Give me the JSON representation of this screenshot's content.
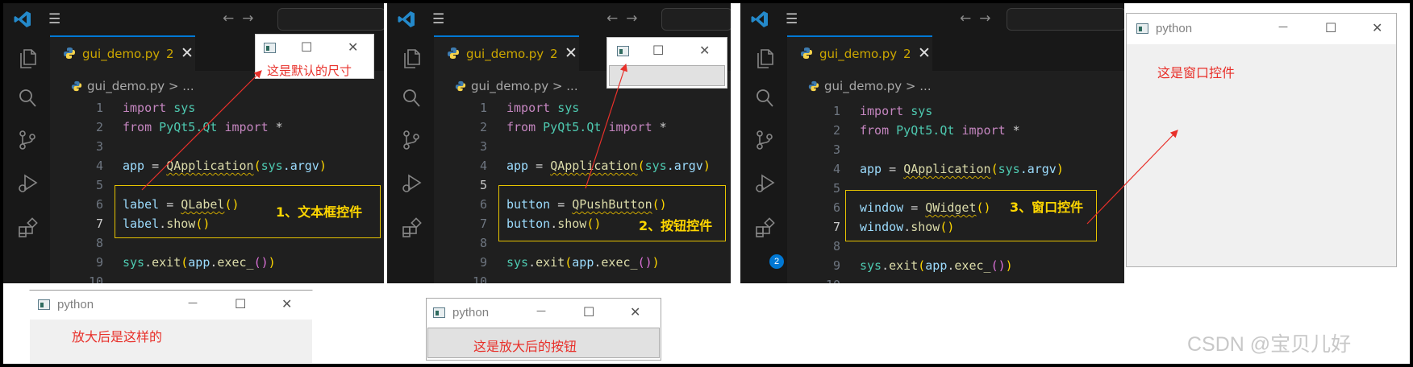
{
  "panels": [
    {
      "tab": {
        "filename": "gui_demo.py",
        "problems": "2",
        "close": "✕"
      },
      "breadcrumb": {
        "file": "gui_demo.py",
        "sep": ">",
        "rest": "..."
      },
      "line_numbers": [
        "1",
        "2",
        "3",
        "4",
        "5",
        "6",
        "7",
        "8",
        "9",
        "10"
      ],
      "code": {
        "l1": {
          "kw": "import",
          "mod": "sys"
        },
        "l2": {
          "kw1": "from",
          "mod": "PyQt5.Qt",
          "kw2": "import",
          "star": "*"
        },
        "l4": {
          "var": "app",
          "eq": "=",
          "fn": "QApplication",
          "mod": "sys",
          "attr": ".argv"
        },
        "l6": {
          "var": "label",
          "eq": "=",
          "fn": "QLabel"
        },
        "l7": {
          "var": "label",
          "method": "show"
        },
        "l9": {
          "mod": "sys",
          "fn": "exit",
          "var": "app",
          "method": "exec_"
        }
      },
      "annotation": "1、文本框控件"
    },
    {
      "tab": {
        "filename": "gui_demo.py",
        "problems": "2",
        "close": "✕"
      },
      "breadcrumb": {
        "file": "gui_demo.py",
        "sep": ">",
        "rest": "..."
      },
      "line_numbers": [
        "1",
        "2",
        "3",
        "4",
        "5",
        "6",
        "7",
        "8",
        "9",
        "10"
      ],
      "code": {
        "l1": {
          "kw": "import",
          "mod": "sys"
        },
        "l2": {
          "kw1": "from",
          "mod": "PyQt5.Qt",
          "kw2": "import",
          "star": "*"
        },
        "l4": {
          "var": "app",
          "eq": "=",
          "fn": "QApplication",
          "mod": "sys",
          "attr": ".argv"
        },
        "l6": {
          "var": "button",
          "eq": "=",
          "fn": "QPushButton"
        },
        "l7": {
          "var": "button",
          "method": "show"
        },
        "l9": {
          "mod": "sys",
          "fn": "exit",
          "var": "app",
          "method": "exec_"
        }
      },
      "annotation": "2、按钮控件"
    },
    {
      "tab": {
        "filename": "gui_demo.py",
        "problems": "2",
        "close": "✕"
      },
      "breadcrumb": {
        "file": "gui_demo.py",
        "sep": ">",
        "rest": "..."
      },
      "line_numbers": [
        "1",
        "2",
        "3",
        "4",
        "5",
        "6",
        "7",
        "8",
        "9",
        "10"
      ],
      "code": {
        "l1": {
          "kw": "import",
          "mod": "sys"
        },
        "l2": {
          "kw1": "from",
          "mod": "PyQt5.Qt",
          "kw2": "import",
          "star": "*"
        },
        "l4": {
          "var": "app",
          "eq": "=",
          "fn": "QApplication",
          "mod": "sys",
          "attr": ".argv"
        },
        "l6": {
          "var": "window",
          "eq": "=",
          "fn": "QWidget"
        },
        "l7": {
          "var": "window",
          "method": "show"
        },
        "l9": {
          "mod": "sys",
          "fn": "exit",
          "var": "app",
          "method": "exec_"
        }
      },
      "annotation": "3、窗口控件",
      "source_control_badge": "2"
    }
  ],
  "small_windows": {
    "label_default": {
      "note": "这是默认的尺寸",
      "minimize": "—",
      "maximize": "☐",
      "close": "✕"
    },
    "button_default": {
      "minimize": "—",
      "maximize": "☐",
      "close": "✕"
    }
  },
  "python_windows": {
    "label_enlarged": {
      "title": "python",
      "text": "放大后是这样的",
      "minimize": "—",
      "maximize": "☐",
      "close": "✕"
    },
    "button_enlarged": {
      "title": "python",
      "text": "这是放大后的按钮",
      "minimize": "—",
      "maximize": "☐",
      "close": "✕"
    },
    "widget_window": {
      "title": "python",
      "text": "这是窗口控件",
      "minimize": "—",
      "maximize": "☐",
      "close": "✕"
    }
  },
  "watermark": "CSDN @宝贝儿好",
  "colors": {
    "accent": "#0078d4",
    "annotation": "#ffd700",
    "arrow": "#e8302a",
    "modified_tab": "#cca700"
  }
}
